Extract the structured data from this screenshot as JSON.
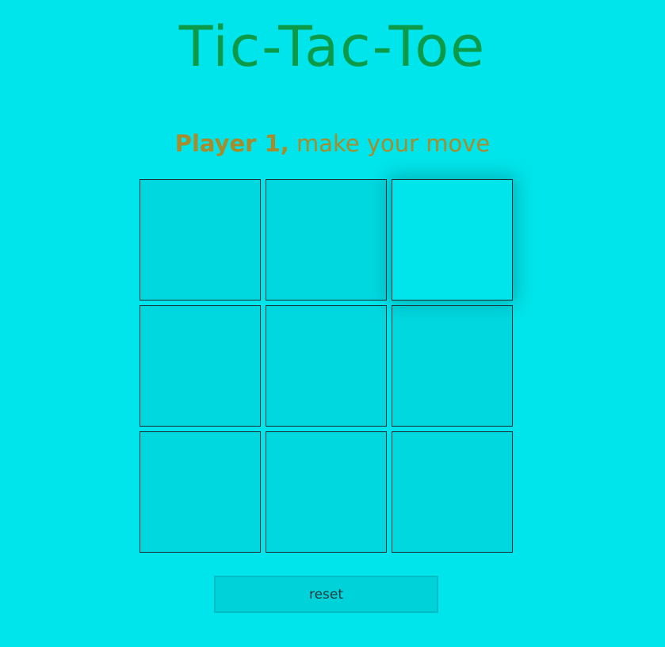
{
  "title": "Tic-Tac-Toe",
  "status": {
    "player": "Player 1,",
    "message": " make your move"
  },
  "board": {
    "cells": [
      "",
      "",
      "",
      "",
      "",
      "",
      "",
      "",
      ""
    ],
    "hovered_cell_index": 2
  },
  "reset_label": "reset",
  "colors": {
    "background": "#00e5eb",
    "title": "#0a9a48",
    "status": "#a88b2a",
    "cell": "#00d8e0",
    "cell_border": "#1a2a2e"
  }
}
